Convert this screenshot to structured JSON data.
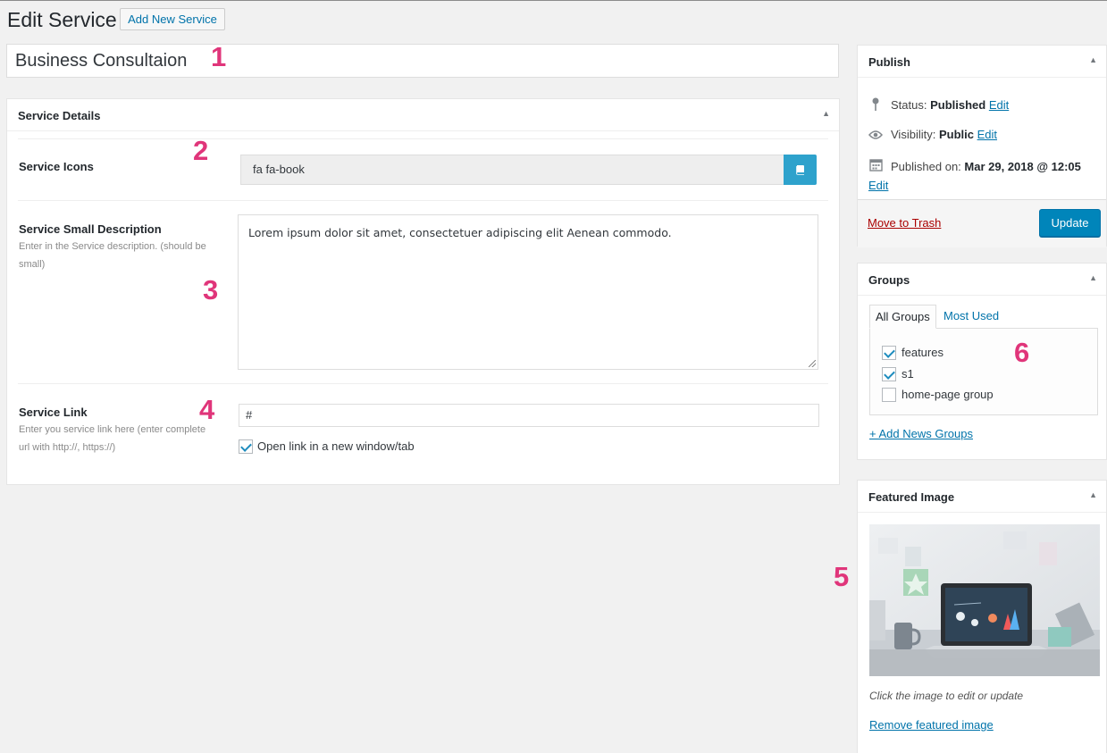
{
  "header": {
    "title": "Edit Service",
    "add_new_label": "Add New Service"
  },
  "post_title": "Business Consultaion",
  "service_details": {
    "box_title": "Service Details",
    "icons_label": "Service Icons",
    "icon_value": "fa fa-book",
    "description_label": "Service Small Description",
    "description_help": "Enter in the Service description. (should be small)",
    "description_value": "Lorem ipsum dolor sit amet, consectetuer adipiscing elit Aenean commodo.",
    "link_label": "Service Link",
    "link_help": "Enter you service link here (enter complete url with http://, https://)",
    "link_value": "#",
    "new_window_label": "Open link in a new window/tab",
    "new_window_checked": true
  },
  "publish": {
    "box_title": "Publish",
    "status_label": "Status:",
    "status_value": "Published",
    "visibility_label": "Visibility:",
    "visibility_value": "Public",
    "published_label": "Published on:",
    "published_value": "Mar 29, 2018 @ 12:05",
    "edit_label": "Edit",
    "trash_label": "Move to Trash",
    "update_label": "Update"
  },
  "groups": {
    "box_title": "Groups",
    "tabs": [
      "All Groups",
      "Most Used"
    ],
    "items": [
      {
        "label": "features",
        "checked": true
      },
      {
        "label": "s1",
        "checked": true
      },
      {
        "label": "home-page group",
        "checked": false
      }
    ],
    "add_label": "+ Add News Groups"
  },
  "featured_image": {
    "box_title": "Featured Image",
    "caption": "Click the image to edit or update",
    "remove_label": "Remove featured image"
  },
  "annotations": [
    "1",
    "2",
    "3",
    "4",
    "5",
    "6"
  ],
  "colors": {
    "accent": "#0073aa",
    "update_button": "#0085ba",
    "annotation": "#e0357a",
    "trash": "#aa0000",
    "icon_button": "#2ea2cc"
  }
}
